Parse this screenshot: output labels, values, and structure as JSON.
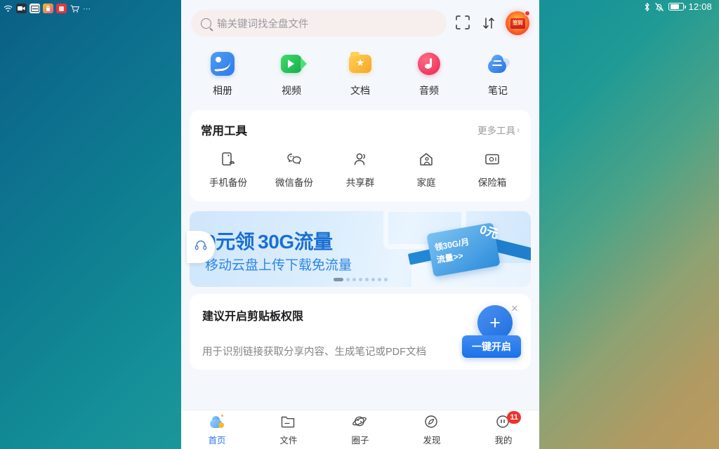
{
  "desktop": {
    "taskbar_icons": [
      {
        "name": "wifi-icon",
        "glyph": "ᵷ"
      },
      {
        "name": "camera-icon",
        "glyph": ""
      },
      {
        "name": "scanner-icon",
        "glyph": ""
      },
      {
        "name": "gallery-icon",
        "glyph": ""
      },
      {
        "name": "app-red-icon",
        "glyph": ""
      },
      {
        "name": "cart-icon",
        "glyph": "🛒"
      },
      {
        "name": "overflow-icon",
        "glyph": "⋯"
      }
    ]
  },
  "statusbar": {
    "bluetooth": "ᛦ",
    "mute": "mute-bell-icon",
    "battery": "battery-icon",
    "time": "12:08"
  },
  "search": {
    "placeholder": "输关键词找全盘文件",
    "value": "",
    "scan_icon": "scan-icon",
    "sort_icon": "sort-icon",
    "sort_glyph": "↓↑",
    "gift_label": "签到"
  },
  "categories": [
    {
      "label": "相册",
      "icon": "album-icon"
    },
    {
      "label": "视频",
      "icon": "video-icon"
    },
    {
      "label": "文档",
      "icon": "document-icon"
    },
    {
      "label": "音频",
      "icon": "audio-icon"
    },
    {
      "label": "笔记",
      "icon": "notes-icon"
    }
  ],
  "tools": {
    "title": "常用工具",
    "more_label": "更多工具",
    "more_chevron": "›",
    "items": [
      {
        "label": "手机备份",
        "icon": "phone-backup-icon"
      },
      {
        "label": "微信备份",
        "icon": "wechat-backup-icon"
      },
      {
        "label": "共享群",
        "icon": "share-group-icon"
      },
      {
        "label": "家庭",
        "icon": "family-icon"
      },
      {
        "label": "保险箱",
        "icon": "safe-box-icon"
      }
    ]
  },
  "banner": {
    "title": "0元领 30G流量",
    "subtitle": "移动云盘上传下载免流量",
    "card_line1": "领30G/月",
    "card_line2": "流量>>",
    "card_zero": "0元",
    "close_glyph": "×",
    "dots_total": 8,
    "dots_active": 0,
    "support_icon": "headset-icon"
  },
  "clipboard": {
    "title": "建议开启剪贴板权限",
    "description": "用于识别链接获取分享内容、生成笔记或PDF文档",
    "close_glyph": "×",
    "button_label": "一键开启",
    "fab_glyph": "+"
  },
  "bottom_nav": [
    {
      "label": "首页",
      "icon": "home-icon",
      "active": true,
      "badge": ""
    },
    {
      "label": "文件",
      "icon": "files-icon",
      "active": false,
      "badge": ""
    },
    {
      "label": "圈子",
      "icon": "circle-group-icon",
      "active": false,
      "badge": ""
    },
    {
      "label": "发现",
      "icon": "discover-icon",
      "active": false,
      "badge": ""
    },
    {
      "label": "我的",
      "icon": "profile-icon",
      "active": false,
      "badge": "11"
    }
  ],
  "colors": {
    "accent": "#2f7ae8",
    "badge": "#f0322c",
    "page_bg": "#f4f7fb"
  }
}
